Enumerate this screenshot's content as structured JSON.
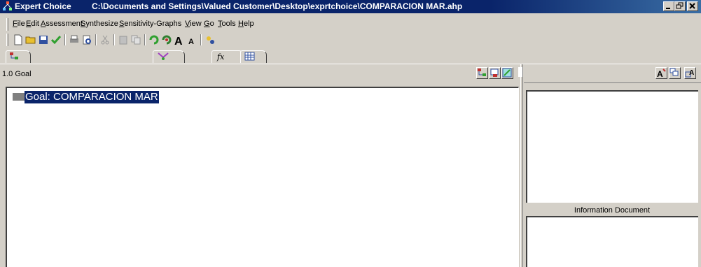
{
  "window": {
    "app_name": "Expert Choice",
    "document_path": "C:\\Documents and Settings\\Valued Customer\\Desktop\\exprtchoice\\COMPARACION MAR.ahp"
  },
  "menu": [
    "File",
    "Edit",
    "Assessment",
    "Synthesize",
    "Sensitivity-Graphs",
    "View",
    "Go",
    "Tools",
    "Help"
  ],
  "toolbar": {
    "buttons": [
      "new-file-icon",
      "open-folder-icon",
      "save-icon",
      "checkmark-icon",
      "print-icon",
      "print-preview-icon",
      "cut-icon",
      "paste-icon",
      "copy-icon",
      "refresh-icon",
      "recalculate-icon",
      "increase-font-icon",
      "decrease-font-icon",
      "settings-icon"
    ]
  },
  "view_tabs": [
    "model-view-tab-icon",
    "ratings-tab-icon",
    "formula-tab-icon",
    "data-grid-tab-icon"
  ],
  "node_panel": {
    "current_node": "1.0 Goal",
    "tree_root": "Goal: COMPARACION MAR"
  },
  "info_panel": {
    "caption": "Information Document"
  },
  "colors": {
    "title_bar": "#0a246a",
    "window_face": "#d4d0c8",
    "selection": "#0a246a"
  }
}
